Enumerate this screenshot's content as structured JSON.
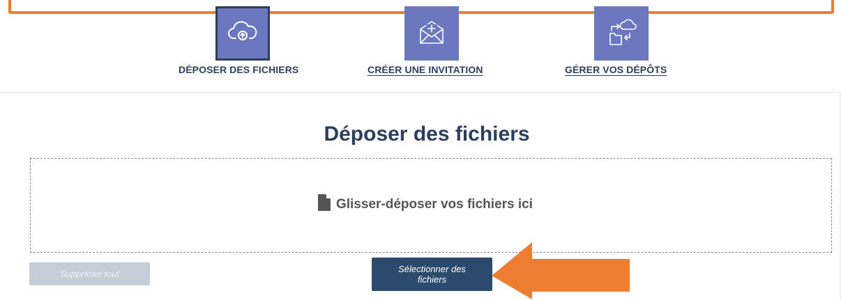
{
  "nav": {
    "items": [
      {
        "label": "DÉPOSER DES FICHIERS",
        "icon": "cloud-upload-icon",
        "active": true
      },
      {
        "label": "CRÉER UNE INVITATION",
        "icon": "mail-plus-icon",
        "active": false
      },
      {
        "label": "GÉRER VOS DÉPÔTS",
        "icon": "cloud-transfer-icon",
        "active": false
      }
    ]
  },
  "main": {
    "title": "Déposer des fichiers",
    "dropzone_text": "Glisser-déposer vos fichiers ici",
    "clear_button": "Supprimer tout",
    "select_button": "Sélectionner des fichiers"
  },
  "colors": {
    "accent_tile": "#6b78bf",
    "dark_blue": "#2c3e5e",
    "button_blue": "#2c4a6e",
    "annotation_orange": "#ed7d31"
  }
}
